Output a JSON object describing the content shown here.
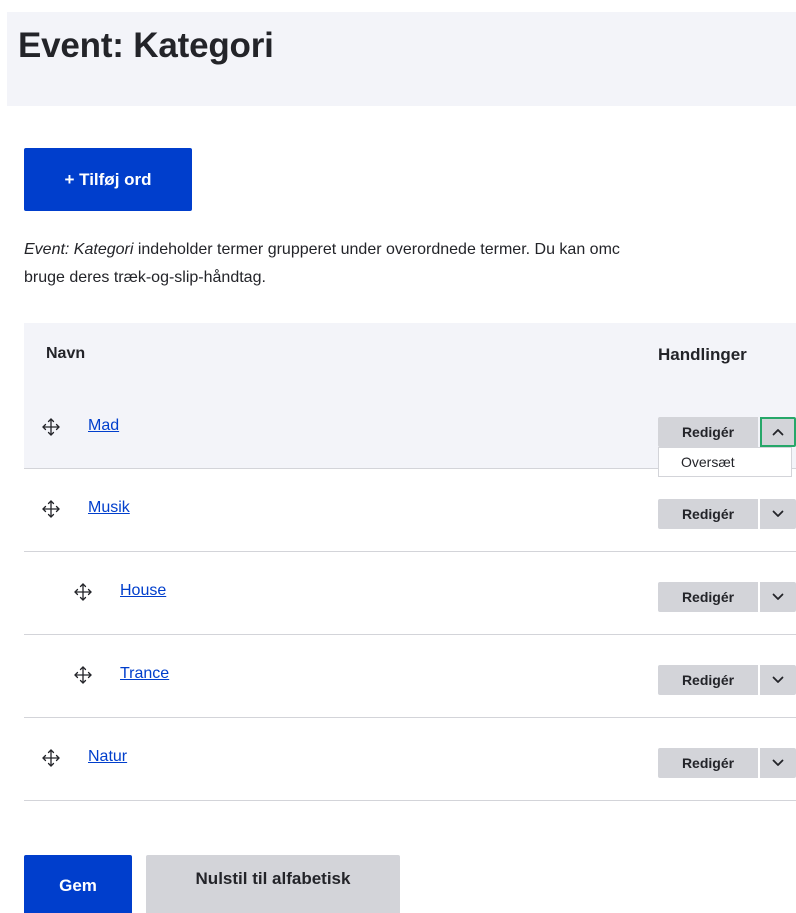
{
  "header": {
    "title": "Event: Kategori"
  },
  "toolbar": {
    "add_label": "+ Tilføj ord"
  },
  "description": {
    "vocab_name": "Event: Kategori",
    "line1_rest": " indeholder termer grupperet under overordnede termer. Du kan omc",
    "line2": "bruge deres træk-og-slip-håndtag."
  },
  "table": {
    "headers": {
      "name": "Navn",
      "actions": "Handlinger"
    },
    "rows": [
      {
        "name": "Mad",
        "depth": 0,
        "edit_label": "Redigér",
        "expanded": true
      },
      {
        "name": "Musik",
        "depth": 0,
        "edit_label": "Redigér",
        "expanded": false
      },
      {
        "name": "House",
        "depth": 1,
        "edit_label": "Redigér",
        "expanded": false
      },
      {
        "name": "Trance",
        "depth": 1,
        "edit_label": "Redigér",
        "expanded": false
      },
      {
        "name": "Natur",
        "depth": 0,
        "edit_label": "Redigér",
        "expanded": false
      }
    ],
    "dropdown": {
      "translate_label": "Oversæt"
    }
  },
  "actions": {
    "save_label": "Gem",
    "reset_label": "Nulstil til alfabetisk"
  },
  "colors": {
    "primary": "#003ecc",
    "header_bg": "#f3f4f9",
    "button_gray": "#d3d4d9",
    "focus_green": "#26a769"
  },
  "icons": {
    "drag": "move-arrows-icon",
    "toggle_open": "chevron-up-icon",
    "toggle_closed": "chevron-down-icon"
  }
}
